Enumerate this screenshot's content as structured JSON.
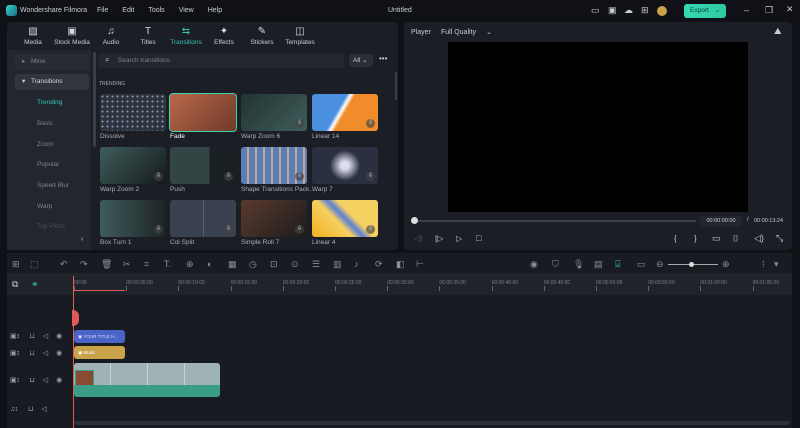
{
  "app": {
    "title": "Wondershare Filmora",
    "document": "Untitled",
    "menu": [
      "File",
      "Edit",
      "Tools",
      "View",
      "Help"
    ],
    "export_label": "Export"
  },
  "tabs": [
    {
      "label": "Media",
      "icon": "media-icon"
    },
    {
      "label": "Stock Media",
      "icon": "stock-media-icon"
    },
    {
      "label": "Audio",
      "icon": "audio-icon"
    },
    {
      "label": "Titles",
      "icon": "titles-icon"
    },
    {
      "label": "Transitions",
      "icon": "transitions-icon",
      "active": true
    },
    {
      "label": "Effects",
      "icon": "effects-icon"
    },
    {
      "label": "Stickers",
      "icon": "stickers-icon"
    },
    {
      "label": "Templates",
      "icon": "templates-icon"
    }
  ],
  "sidebar": {
    "groups": [
      {
        "label": "Mine"
      },
      {
        "label": "Transitions"
      }
    ],
    "items": [
      "Trending",
      "Basic",
      "Zoom",
      "Popular",
      "Speed Blur",
      "Warp",
      "Top Picks"
    ],
    "active": "Trending"
  },
  "search": {
    "placeholder": "Search transitions",
    "filter": "All"
  },
  "section_title": "TRENDING",
  "transitions": [
    "Dissolve",
    "Fade",
    "Warp Zoom 6",
    "Linear 14",
    "Warp Zoom 2",
    "Push",
    "Shape Transitions Pack...",
    "Warp 7",
    "Box Turn 1",
    "Col Split",
    "Simple Roll 7",
    "Linear 4"
  ],
  "player": {
    "label": "Player",
    "quality": "Full Quality",
    "current_time": "00:00:00:00",
    "total_time": "00:00:13:24",
    "progress": 0
  },
  "timeline": {
    "ruler": [
      "00:00",
      "00:00:05:00",
      "00:00:10:00",
      "00:00:15:00",
      "00:00:20:00",
      "00:00:25:00",
      "00:00:30:00",
      "00:00:35:00",
      "00:00:40:00",
      "00:00:45:00",
      "00:00:50:00",
      "00:00:55:00",
      "00:01:00:00",
      "00:01:05:00"
    ],
    "clips": {
      "title": "YOUR TITLE H...",
      "music": "Music"
    },
    "tracks": [
      "3",
      "2",
      "1",
      "1"
    ],
    "zoom_level": 0.5
  },
  "colors": {
    "accent": "#34c7b3",
    "title_clip": "#4a63c9",
    "music_clip": "#c9a24a",
    "video_clip": "#3a9d86",
    "playhead": "#e05a5a"
  }
}
